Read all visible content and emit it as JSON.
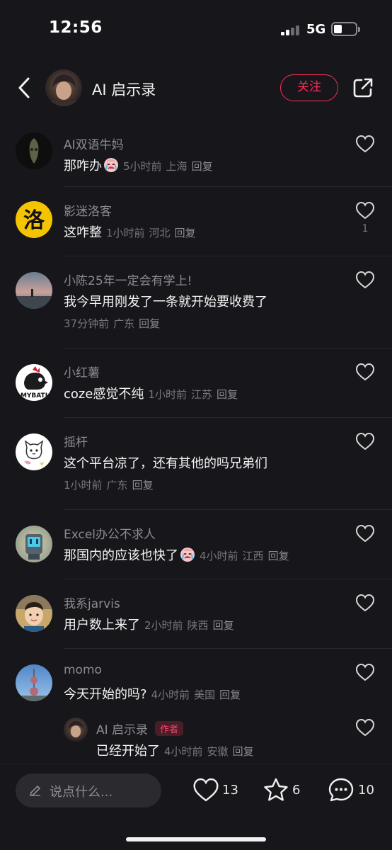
{
  "status_bar": {
    "time": "12:56",
    "network": "5G"
  },
  "header": {
    "title": "AI 启示录",
    "follow_label": "关注"
  },
  "comments": [
    {
      "name": "AI双语牛妈",
      "text": "那咋办",
      "time": "5小时前",
      "location": "上海",
      "reply": "回复",
      "likes": "",
      "has_emoji": true
    },
    {
      "name": "影迷洛客",
      "text": "这咋整",
      "time": "1小时前",
      "location": "河北",
      "reply": "回复",
      "likes": "1",
      "has_emoji": false
    },
    {
      "name": "小陈25年一定会有学上!",
      "text": "我今早用刚发了一条就开始要收费了",
      "time": "37分钟前",
      "location": "广东",
      "reply": "回复",
      "likes": "",
      "has_emoji": false
    },
    {
      "name": "小红薯",
      "text": "coze感觉不纯",
      "time": "1小时前",
      "location": "江苏",
      "reply": "回复",
      "likes": "",
      "has_emoji": false
    },
    {
      "name": "摇杆",
      "text": "这个平台凉了，还有其他的吗兄弟们",
      "time": "1小时前",
      "location": "广东",
      "reply": "回复",
      "likes": "",
      "has_emoji": false
    },
    {
      "name": "Excel办公不求人",
      "text": "那国内的应该也快了",
      "time": "4小时前",
      "location": "江西",
      "reply": "回复",
      "likes": "",
      "has_emoji": true
    },
    {
      "name": "我系jarvis",
      "text": "用户数上来了",
      "time": "2小时前",
      "location": "陕西",
      "reply": "回复",
      "likes": "",
      "has_emoji": false
    },
    {
      "name": "momo",
      "text": "今天开始的吗?",
      "time": "4小时前",
      "location": "美国",
      "reply": "回复",
      "likes": "",
      "has_emoji": false
    }
  ],
  "reply": {
    "name": "AI 启示录",
    "author_tag": "作者",
    "text": "已经开始了",
    "time": "4小时前",
    "location": "安徽",
    "reply": "回复"
  },
  "bottom_bar": {
    "input_placeholder": "说点什么...",
    "like_count": "13",
    "star_count": "6",
    "comment_count": "10"
  },
  "colors": {
    "background": "#17171b",
    "accent": "#fe2c55"
  }
}
